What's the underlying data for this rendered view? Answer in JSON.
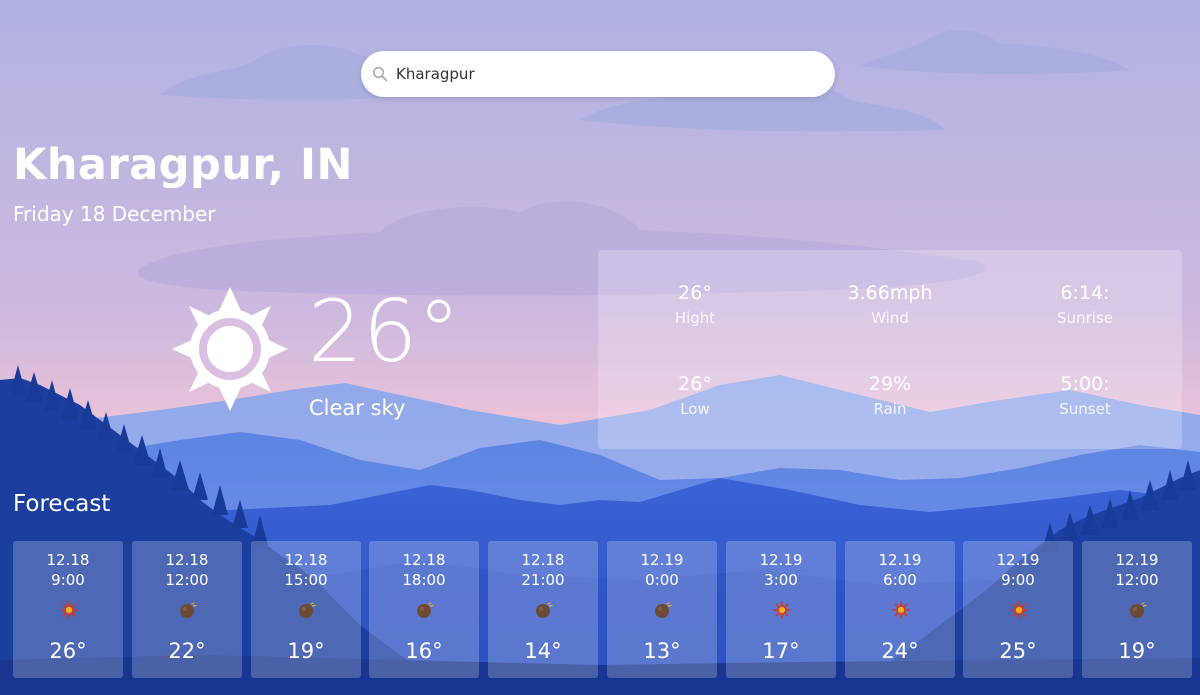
{
  "search": {
    "value": "Kharagpur",
    "placeholder": ""
  },
  "location": {
    "city": "Kharagpur, IN",
    "date": "Friday 18 December"
  },
  "current": {
    "icon": "sun-icon",
    "temperature": "26°",
    "condition": "Clear sky"
  },
  "details": [
    {
      "value": "26°",
      "label": "Hight"
    },
    {
      "value": "3.66mph",
      "label": "Wind"
    },
    {
      "value": "6:14:",
      "label": "Sunrise"
    },
    {
      "value": "26°",
      "label": "Low"
    },
    {
      "value": "29%",
      "label": "Rain"
    },
    {
      "value": "5:00:",
      "label": "Sunset"
    }
  ],
  "forecast": {
    "title": "Forecast",
    "items": [
      {
        "date": "12.18",
        "time": "9:00",
        "icon": "sun-icon",
        "temp": "26°"
      },
      {
        "date": "12.18",
        "time": "12:00",
        "icon": "moon-icon",
        "temp": "22°"
      },
      {
        "date": "12.18",
        "time": "15:00",
        "icon": "moon-icon",
        "temp": "19°"
      },
      {
        "date": "12.18",
        "time": "18:00",
        "icon": "moon-icon",
        "temp": "16°"
      },
      {
        "date": "12.18",
        "time": "21:00",
        "icon": "moon-icon",
        "temp": "14°"
      },
      {
        "date": "12.19",
        "time": "0:00",
        "icon": "moon-icon",
        "temp": "13°"
      },
      {
        "date": "12.19",
        "time": "3:00",
        "icon": "sun-icon",
        "temp": "17°"
      },
      {
        "date": "12.19",
        "time": "6:00",
        "icon": "sun-icon",
        "temp": "24°"
      },
      {
        "date": "12.19",
        "time": "9:00",
        "icon": "sun-icon",
        "temp": "25°"
      },
      {
        "date": "12.19",
        "time": "12:00",
        "icon": "moon-icon",
        "temp": "19°"
      }
    ]
  },
  "colors": {
    "sky_top": "#b3b3e2",
    "sky_bottom": "#ecc4d8",
    "mountain_light": "#7d97e6",
    "mountain_mid": "#3f6bd8",
    "mountain_dark": "#1d3f9e",
    "forest": "#16307f",
    "sun_icon": "#d9341f",
    "moon_icon": "#6b4a36"
  }
}
